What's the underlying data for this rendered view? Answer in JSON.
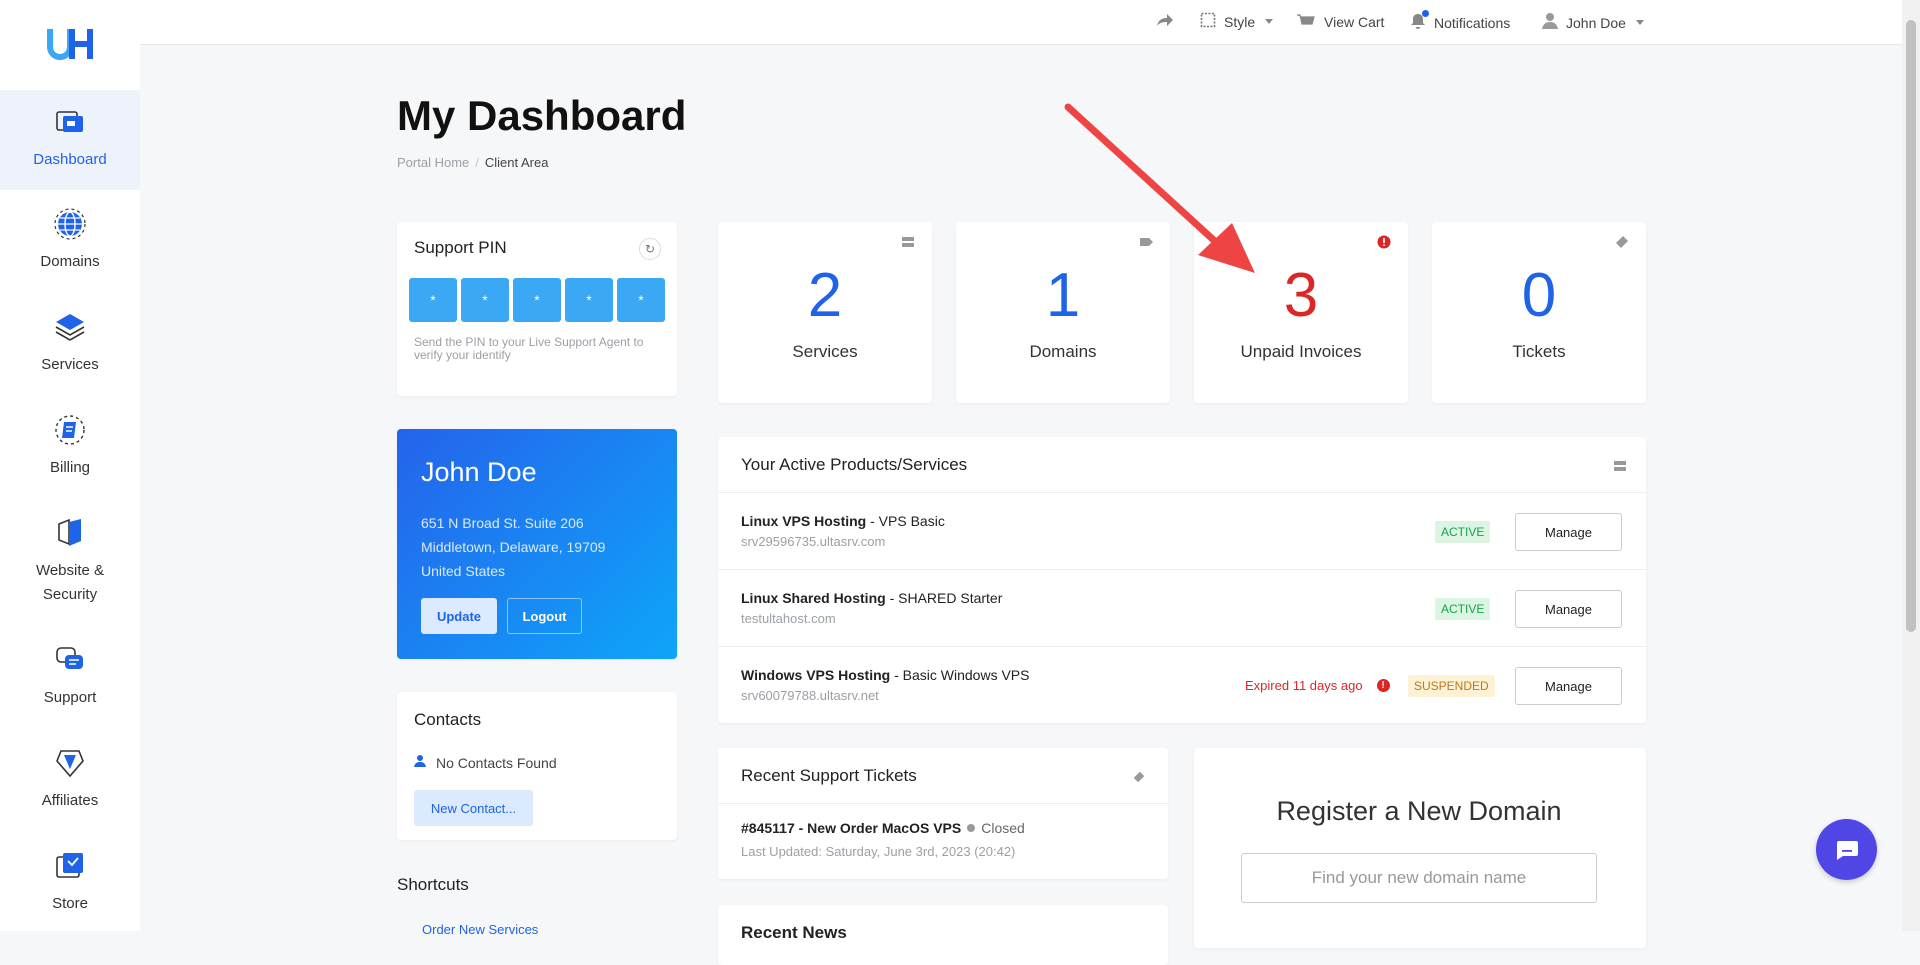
{
  "nav": {
    "items": [
      {
        "label": "Dashboard",
        "icon": "dashboard-icon"
      },
      {
        "label": "Domains",
        "icon": "globe-icon"
      },
      {
        "label": "Services",
        "icon": "stack-icon"
      },
      {
        "label": "Billing",
        "icon": "billing-icon"
      },
      {
        "label": "Website & Security",
        "icon": "shield-icon"
      },
      {
        "label": "Support",
        "icon": "support-icon"
      },
      {
        "label": "Affiliates",
        "icon": "affiliates-icon"
      },
      {
        "label": "Store",
        "icon": "store-icon"
      }
    ]
  },
  "topbar": {
    "style": "Style",
    "view_cart": "View Cart",
    "notifications": "Notifications",
    "user": "John Doe"
  },
  "page": {
    "title": "My Dashboard",
    "breadcrumb": [
      "Portal Home",
      "Client Area"
    ]
  },
  "support_pin": {
    "title": "Support PIN",
    "digits": [
      "*",
      "*",
      "*",
      "*",
      "*"
    ],
    "help": "Send the PIN to your Live Support Agent to verify your identify"
  },
  "profile": {
    "name": "John Doe",
    "address": [
      "651 N Broad St. Suite 206",
      "Middletown, Delaware, 19709",
      "United States"
    ],
    "update": "Update",
    "logout": "Logout"
  },
  "contacts": {
    "title": "Contacts",
    "empty": "No Contacts Found",
    "new_button": "New Contact..."
  },
  "shortcuts": {
    "title": "Shortcuts",
    "first_link": "Order New Services"
  },
  "stats": [
    {
      "value": "2",
      "label": "Services"
    },
    {
      "value": "1",
      "label": "Domains"
    },
    {
      "value": "3",
      "label": "Unpaid Invoices"
    },
    {
      "value": "0",
      "label": "Tickets"
    }
  ],
  "products": {
    "title": "Your Active Products/Services",
    "rows": [
      {
        "name": "Linux VPS Hosting",
        "plan": " - VPS Basic",
        "host": "srv29596735.ultasrv.com",
        "status": "ACTIVE",
        "action": "Manage"
      },
      {
        "name": "Linux Shared Hosting",
        "plan": " - SHARED Starter",
        "host": "testultahost.com",
        "status": "ACTIVE",
        "action": "Manage"
      },
      {
        "name": "Windows VPS Hosting",
        "plan": " - Basic Windows VPS",
        "host": "srv60079788.ultasrv.net",
        "status": "SUSPENDED",
        "note": "Expired 11 days ago",
        "action": "Manage"
      }
    ]
  },
  "tickets": {
    "title": "Recent Support Tickets",
    "items": [
      {
        "title": "#845117 - New Order MacOS VPS",
        "status": "Closed",
        "updated": "Last Updated: Saturday, June 3rd, 2023 (20:42)"
      }
    ]
  },
  "news": {
    "title": "Recent News"
  },
  "register_domain": {
    "title": "Register a New Domain",
    "placeholder": "Find your new domain name"
  },
  "colors": {
    "accent": "#1f63e8",
    "alert": "#dc2626",
    "pin": "#3aa8f5",
    "chat": "#4f46e5",
    "arrow": "#ef4444"
  }
}
